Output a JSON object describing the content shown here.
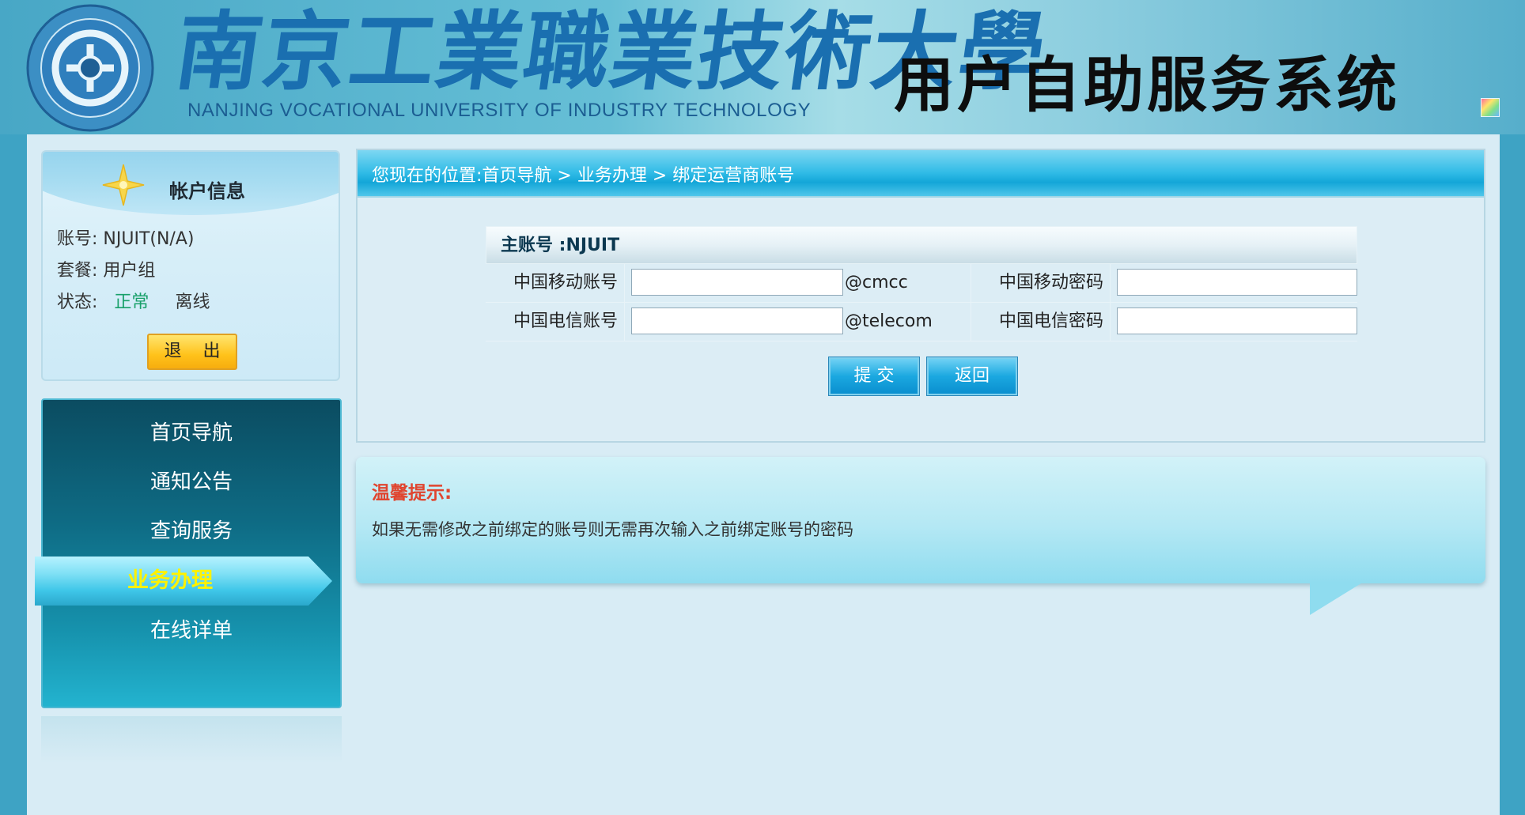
{
  "header": {
    "university_cn": "南京工業職業技術大學",
    "university_en": "NANJING VOCATIONAL UNIVERSITY OF INDUSTRY TECHNOLOGY",
    "system_title": "用户自助服务系统"
  },
  "account": {
    "title": "帐户信息",
    "account_label": "账号:",
    "account_value": "NJUIT(N/A)",
    "package_label": "套餐:",
    "package_value": "用户组",
    "status_label": "状态:",
    "status_online": "正常",
    "status_offline": "离线",
    "logout": "退 出"
  },
  "nav": {
    "items": [
      "首页导航",
      "通知公告",
      "查询服务",
      "业务办理",
      "在线详单"
    ],
    "active": "业务办理"
  },
  "breadcrumb": "您现在的位置:首页导航 > 业务办理 > 绑定运营商账号",
  "form": {
    "title": "主账号 :NJUIT",
    "cmcc_account_label": "中国移动账号",
    "cmcc_suffix": "@cmcc",
    "cmcc_password_label": "中国移动密码",
    "telecom_account_label": "中国电信账号",
    "telecom_suffix": "@telecom",
    "telecom_password_label": "中国电信密码",
    "cmcc_account_value": "",
    "cmcc_password_value": "",
    "telecom_account_value": "",
    "telecom_password_value": "",
    "submit": "提 交",
    "back": "返回"
  },
  "tip": {
    "title": "温馨提示:",
    "text": "如果无需修改之前绑定的账号则无需再次输入之前绑定账号的密码"
  },
  "colors": {
    "brand_blue": "#1a6fb0",
    "active_nav_text": "#fff200",
    "tip_title": "#e0452f",
    "status_online": "#18a06a"
  },
  "icons": [
    "university-seal-icon",
    "star-icon",
    "theme-color-icon"
  ]
}
